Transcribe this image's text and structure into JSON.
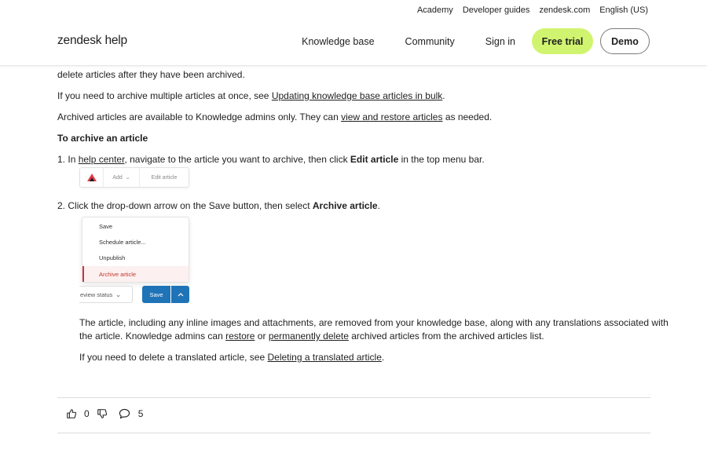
{
  "header": {
    "utility_links": [
      "Academy",
      "Developer guides",
      "zendesk.com",
      "English (US)"
    ],
    "logo": "zendesk help",
    "nav": {
      "knowledge_base": "Knowledge base",
      "community": "Community",
      "sign_in": "Sign in",
      "free_trial": "Free trial",
      "demo": "Demo"
    }
  },
  "content": {
    "para1": "delete articles after they have been archived.",
    "para2_prefix": "If you need to archive multiple articles at once, see ",
    "para2_link": "Updating knowledge base articles in bulk",
    "para2_suffix": ".",
    "para3_prefix": "Archived articles are available to Knowledge admins only. They can ",
    "para3_link": "view and restore articles",
    "para3_suffix": " as needed.",
    "heading": "To archive an article",
    "step1_num": "1.",
    "step1_prefix": "In ",
    "step1_link": "help center",
    "step1_mid": ", navigate to the article you want to archive, then click ",
    "step1_bold": "Edit article",
    "step1_suffix": " in the top menu bar.",
    "shot1": {
      "add": "Add",
      "edit": "Edit article"
    },
    "step2_num": "2.",
    "step2_prefix": "Click the drop-down arrow on the Save button, then select ",
    "step2_bold": "Archive article",
    "step2_suffix": ".",
    "shot2": {
      "menu_items": [
        "Save",
        "Schedule article...",
        "Unpublish",
        "Archive article"
      ],
      "review_status": "eview status",
      "save": "Save"
    },
    "para4_line1": "The article, including any inline images and attachments, are removed from your knowledge base, along with any translations associated with",
    "para4_l2_prefix": "the article. Knowledge admins can ",
    "para4_link1": "restore",
    "para4_l2_or": " or ",
    "para4_link2": "permanently delete",
    "para4_l2_suffix": " archived articles from the archived articles list.",
    "para5_prefix": "If you need to delete a translated article, see ",
    "para5_link": "Deleting a translated article",
    "para5_suffix": "."
  },
  "feedback": {
    "upvotes": "0",
    "comments": "5"
  },
  "colors": {
    "accent_trial": "#d1f470",
    "save_blue": "#1f73b7",
    "archive_red": "#cc3340"
  }
}
